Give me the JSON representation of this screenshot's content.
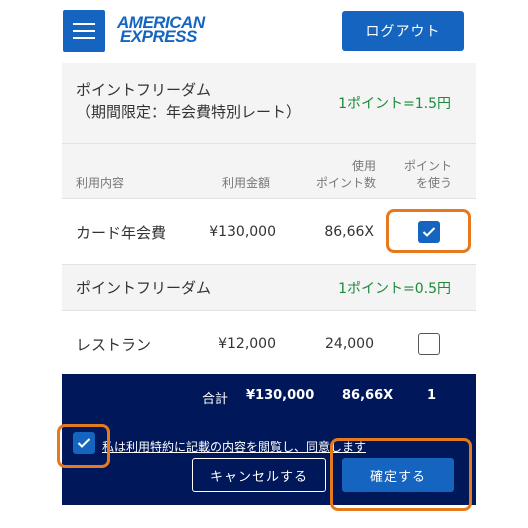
{
  "header": {
    "logo_line1": "AMERICAN",
    "logo_line2": "EXPRESS",
    "logout_label": "ログアウト"
  },
  "section1": {
    "title_line1": "ポイントフリーダム",
    "title_line2": "（期間限定：年会費特別レート）",
    "rate": "1ポイント=1.5円"
  },
  "table_header": {
    "item": "利用内容",
    "amount": "利用金額",
    "points_line1": "使用",
    "points_line2": "ポイント数",
    "use_line1": "ポイント",
    "use_line2": "を使う"
  },
  "rows": [
    {
      "item": "カード年会費",
      "amount": "¥130,000",
      "points": "86,66X",
      "checked": true
    },
    {
      "item": "レストラン",
      "amount": "¥12,000",
      "points": "24,000",
      "checked": false
    }
  ],
  "section2": {
    "title": "ポイントフリーダム",
    "rate": "1ポイント=0.5円"
  },
  "footer": {
    "total_label": "合計",
    "total_amount": "¥130,000",
    "total_points": "86,66X",
    "total_count": "1",
    "agree_text": "私は利用特約に記載の内容を閲覧し、同意します",
    "agree_checked": true,
    "cancel_label": "キャンセルする",
    "confirm_label": "確定する"
  },
  "colors": {
    "brand_blue": "#1565c0",
    "footer_navy": "#00175a",
    "rate_green": "#1c8a3a",
    "highlight_orange": "#e6781e"
  }
}
